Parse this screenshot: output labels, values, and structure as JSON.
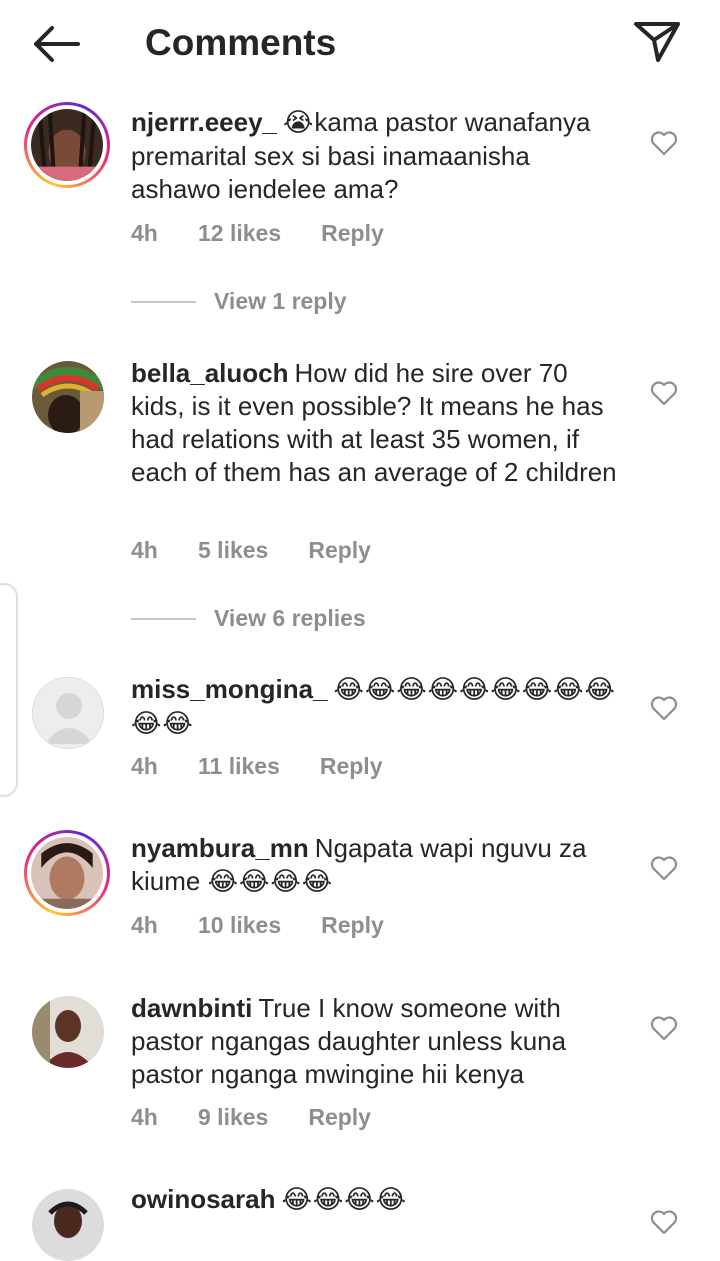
{
  "header": {
    "title": "Comments",
    "back_icon": "arrow-left-icon",
    "share_icon": "paper-plane-icon"
  },
  "comments": [
    {
      "username": "njerrr.eeey_",
      "emoji_prefix": "😭",
      "text": "kama pastor wanafanya premarital sex si basi inamaanisha ashawo iendelee ama?",
      "time": "4h",
      "likes": "12 likes",
      "reply": "Reply",
      "view_replies": "View 1 reply",
      "has_story": true
    },
    {
      "username": "bella_aluoch",
      "text": "How did he sire over 70 kids, is it even possible? It means he has had relations with at least 35 women, if each of them has an average of 2 children",
      "time": "4h",
      "likes": "5 likes",
      "reply": "Reply",
      "view_replies": "View 6 replies",
      "has_story": false
    },
    {
      "username": "miss_mongina_",
      "emoji_suffix": "😂😂😂😂😂😂😂😂😂😂😂",
      "time": "4h",
      "likes": "11 likes",
      "reply": "Reply",
      "has_story": false
    },
    {
      "username": "nyambura_mn",
      "text": "Ngapata wapi nguvu za kiume",
      "emoji_suffix": "😂😂😂😂",
      "time": "4h",
      "likes": "10 likes",
      "reply": "Reply",
      "has_story": true
    },
    {
      "username": "dawnbinti",
      "text": "True I know someone with pastor ngangas daughter unless kuna pastor nganga mwingine hii kenya",
      "time": "4h",
      "likes": "9 likes",
      "reply": "Reply",
      "has_story": false
    },
    {
      "username": "owinosarah",
      "emoji_suffix": "😂😂😂😂",
      "has_story": false
    }
  ],
  "colors": {
    "text": "#262626",
    "muted": "#8e8e8e",
    "story_ring": "#ee2a7b"
  }
}
